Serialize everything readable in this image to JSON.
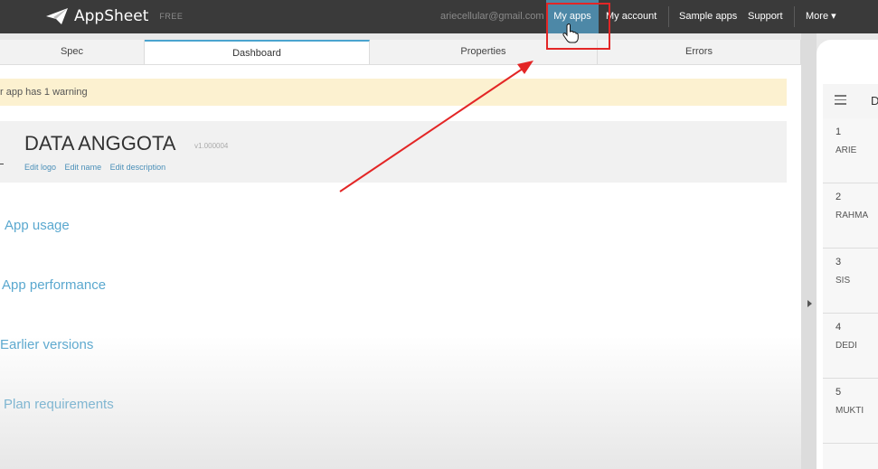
{
  "brand": {
    "name": "AppSheet",
    "tag": "FREE"
  },
  "nav": {
    "email": "ariecellular@gmail.com",
    "my_apps": "My apps",
    "my_account": "My account",
    "sample_apps": "Sample apps",
    "support": "Support",
    "more": "More ▾"
  },
  "tabs": [
    "Spec",
    "Dashboard",
    "Properties",
    "Errors"
  ],
  "warning": "r app has 1 warning",
  "app": {
    "title": "DATA ANGGOTA",
    "version": "v1.000004",
    "links": [
      "Edit logo",
      "Edit name",
      "Edit description"
    ]
  },
  "sections": [
    "App usage",
    "App performance",
    "Earlier versions",
    "Plan requirements"
  ],
  "preview": {
    "header_initial": "D",
    "rows": [
      {
        "num": "1",
        "name": "ARIE"
      },
      {
        "num": "2",
        "name": "RAHMA"
      },
      {
        "num": "3",
        "name": "SIS"
      },
      {
        "num": "4",
        "name": "DEDI"
      },
      {
        "num": "5",
        "name": "MUKTI"
      }
    ]
  },
  "colors": {
    "nav_bg": "#3a3a3a",
    "accent": "#4aa4cf",
    "highlight": "#e32626",
    "warning_bg": "#fcf1d0"
  }
}
